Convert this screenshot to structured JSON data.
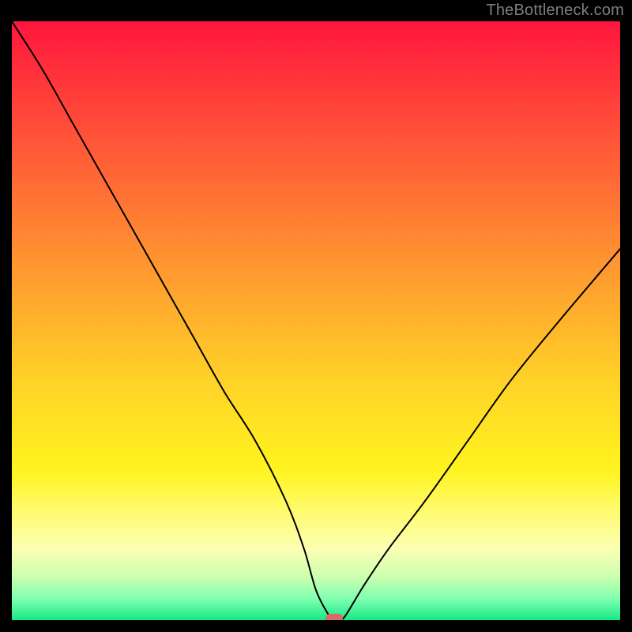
{
  "watermark": "TheBottleneck.com",
  "chart_data": {
    "type": "line",
    "title": "",
    "xlabel": "",
    "ylabel": "",
    "xlim": [
      0,
      100
    ],
    "ylim": [
      0,
      100
    ],
    "grid": false,
    "curve_description": "Bottleneck percentage vs. parameter — V-shaped curve with minimum ~0 around x≈53 and a small flat bottom marker",
    "marker": {
      "x": 53,
      "y": 0,
      "shape": "pill",
      "color": "#d86a6a"
    },
    "gradient_stops": [
      {
        "offset": 0.0,
        "color": "#ff163e"
      },
      {
        "offset": 0.2,
        "color": "#ff5538"
      },
      {
        "offset": 0.4,
        "color": "#ff9430"
      },
      {
        "offset": 0.6,
        "color": "#ffd228"
      },
      {
        "offset": 0.75,
        "color": "#fff41f"
      },
      {
        "offset": 0.82,
        "color": "#fffb70"
      },
      {
        "offset": 0.88,
        "color": "#fcffb3"
      },
      {
        "offset": 0.93,
        "color": "#c9ffb0"
      },
      {
        "offset": 0.965,
        "color": "#7dffb0"
      },
      {
        "offset": 1.0,
        "color": "#17e884"
      }
    ],
    "series": [
      {
        "name": "bottleneck",
        "x": [
          0,
          5,
          10,
          15,
          20,
          25,
          30,
          35,
          40,
          45,
          48,
          50,
          52,
          53,
          54,
          55,
          58,
          62,
          68,
          75,
          82,
          90,
          100
        ],
        "y": [
          100,
          92,
          83,
          74,
          65,
          56,
          47,
          38,
          30,
          20,
          12,
          5,
          1,
          0,
          0,
          1,
          6,
          12,
          20,
          30,
          40,
          50,
          62
        ]
      }
    ]
  }
}
